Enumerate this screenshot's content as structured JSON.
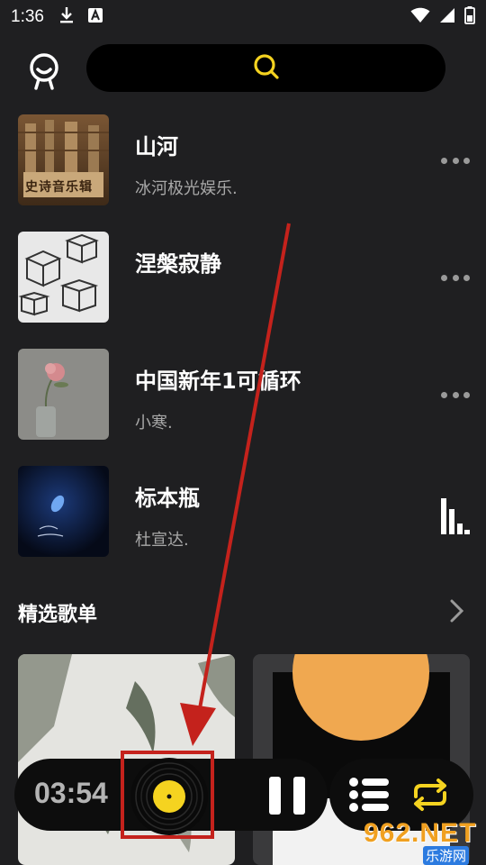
{
  "status": {
    "time": "1:36"
  },
  "search": {
    "icon": "search-icon"
  },
  "songs": [
    {
      "title": "山河",
      "artist": "冰河极光娱乐.",
      "cover_text": "史诗音乐辑",
      "state": "more"
    },
    {
      "title": "涅槃寂静",
      "artist": "",
      "state": "more"
    },
    {
      "title": "中国新年1可循环",
      "artist": "小寒.",
      "state": "more"
    },
    {
      "title": "标本瓶",
      "artist": "杜宣达.",
      "state": "playing"
    }
  ],
  "section": {
    "title": "精选歌单"
  },
  "player": {
    "time": "03:54"
  },
  "colors": {
    "accent": "#f5d320",
    "background": "#1f1f21",
    "annotation": "#c4221c"
  },
  "watermark": {
    "text": "962.NET",
    "sub": "乐游网"
  }
}
